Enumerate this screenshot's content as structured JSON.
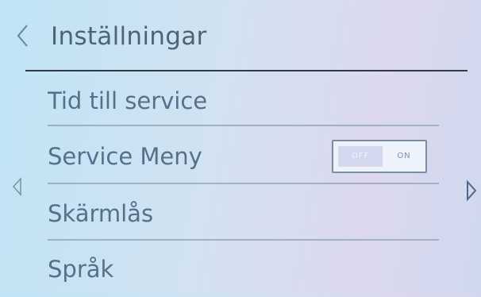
{
  "header": {
    "title": "Inställningar"
  },
  "menu": {
    "items": [
      {
        "label": "Tid till service"
      },
      {
        "label": "Service Meny"
      },
      {
        "label": "Skärmlås"
      },
      {
        "label": "Språk"
      }
    ]
  },
  "service_toggle": {
    "off_label": "OFF",
    "on_label": "ON",
    "state": "off"
  },
  "icons": {
    "back": "chevron-left-icon",
    "prev": "triangle-left-icon",
    "next": "triangle-right-icon"
  },
  "colors": {
    "text": "#55708a",
    "divider": "#8fa3b3",
    "header_line": "#2f3c47"
  }
}
